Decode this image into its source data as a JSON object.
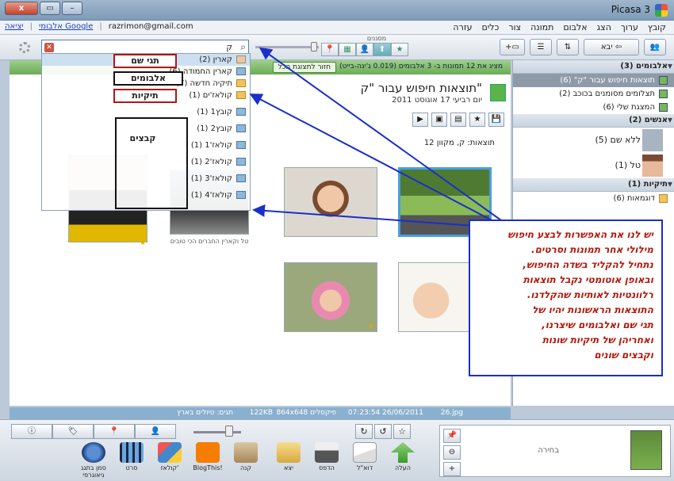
{
  "window": {
    "title": "Picasa 3",
    "close_label": "x",
    "minimize_label": "–",
    "restore_label": "▭"
  },
  "menu": [
    "קובץ",
    "ערוך",
    "הצג",
    "אלבום",
    "תמונה",
    "צור",
    "כלים",
    "עזרה"
  ],
  "account": {
    "email": "razrimon@gmail.com",
    "web_albums": "אלבומי Google",
    "sign_out": "יציאה"
  },
  "toolbar": {
    "import": "יבא",
    "filters_label": "מסננים",
    "search_value": "ק",
    "filter_icons": [
      "★",
      "⬆",
      "👤",
      "▦",
      "📍"
    ]
  },
  "dropdown": {
    "items": [
      {
        "label": "קארין (2)",
        "icon": "tag-icon",
        "selected": true
      },
      {
        "label": "קארין החמודה (6)",
        "icon": "album-icon"
      },
      {
        "label": "תיקיה חדשה (7)",
        "icon": "folder-icon"
      },
      {
        "label": "קולאז'ים (1)",
        "icon": "folder-icon"
      },
      {
        "label": "קובץ1 (1)",
        "icon": "image-icon"
      },
      {
        "label": "קובץ2 (1)",
        "icon": "image-icon"
      },
      {
        "label": "קולאז'1 (1)",
        "icon": "image-icon"
      },
      {
        "label": "קולאז'2 (1)",
        "icon": "image-icon"
      },
      {
        "label": "קולאז'3 (1)",
        "icon": "image-icon"
      },
      {
        "label": "קולאז'4 (1)",
        "icon": "image-icon"
      }
    ],
    "annotations": {
      "name_tags": "תגי שם",
      "albums": "אלבומים",
      "folders": "תיקיות",
      "files": "קבצים"
    }
  },
  "results": {
    "show_all": "חזור לתצוגת הכל",
    "info": "מציג את 12 תמונות ב- 3 אלבומים (0.019 ג'יגה-בייט)",
    "title": "תוצאות חיפוש עבור \"ק\"",
    "date": "יום רביעי 17 אוגוסט 2011",
    "count": "12 תוצאות: ק, מקוון",
    "caption": "טל וקארין החברים הכי טובים",
    "actions": [
      "▶",
      "▣",
      "▤",
      "★",
      "💾"
    ]
  },
  "sidebar": {
    "albums_header": "אלבומים (3)",
    "albums": [
      {
        "label": "תוצאות חיפוש עבור \"ק\" (6)",
        "selected": true
      },
      {
        "label": "תצלומים מסומנים בכוכב (2)"
      },
      {
        "label": "המצגת שלי (6)"
      }
    ],
    "people_header": "אנשים (2)",
    "people": [
      {
        "label": "ללא שם (5)"
      },
      {
        "label": "טל (1)"
      }
    ],
    "folders_header": "תיקיות (1)",
    "folders": [
      {
        "label": "דוגמאות (6)"
      }
    ]
  },
  "callout": {
    "lines": [
      "יש לנו את האפשרות לבצע חיפוש",
      "מילולי אחר תמונות וסרטים.",
      "נתחיל להקליד בשדה החיפוש,",
      "ובאופן אוטומטי נקבל תוצאות",
      "רלוונטיות לאותיות שהקלדנו.",
      "התוצאות הראשונות יהיו של",
      "תגי שם ואלבומים שיצרנו,",
      "ואחריהן של תיקיות שונות",
      "וקבצים שונים"
    ]
  },
  "status": {
    "filename": "26.jpg",
    "datetime": "07:23:54 26/06/2011",
    "dimensions": "864x648 פיקסלים",
    "size": "122KB",
    "tags": "תגים: טיולים בארץ"
  },
  "bottom": {
    "tray_label": "בחירה",
    "tools": [
      "העלה",
      "דוא\"ל",
      "הדפס",
      "יצא",
      "קנה",
      "BlogThis!",
      "קולאז'",
      "סרט",
      "סמן בתגג גיאוגרפי"
    ]
  }
}
